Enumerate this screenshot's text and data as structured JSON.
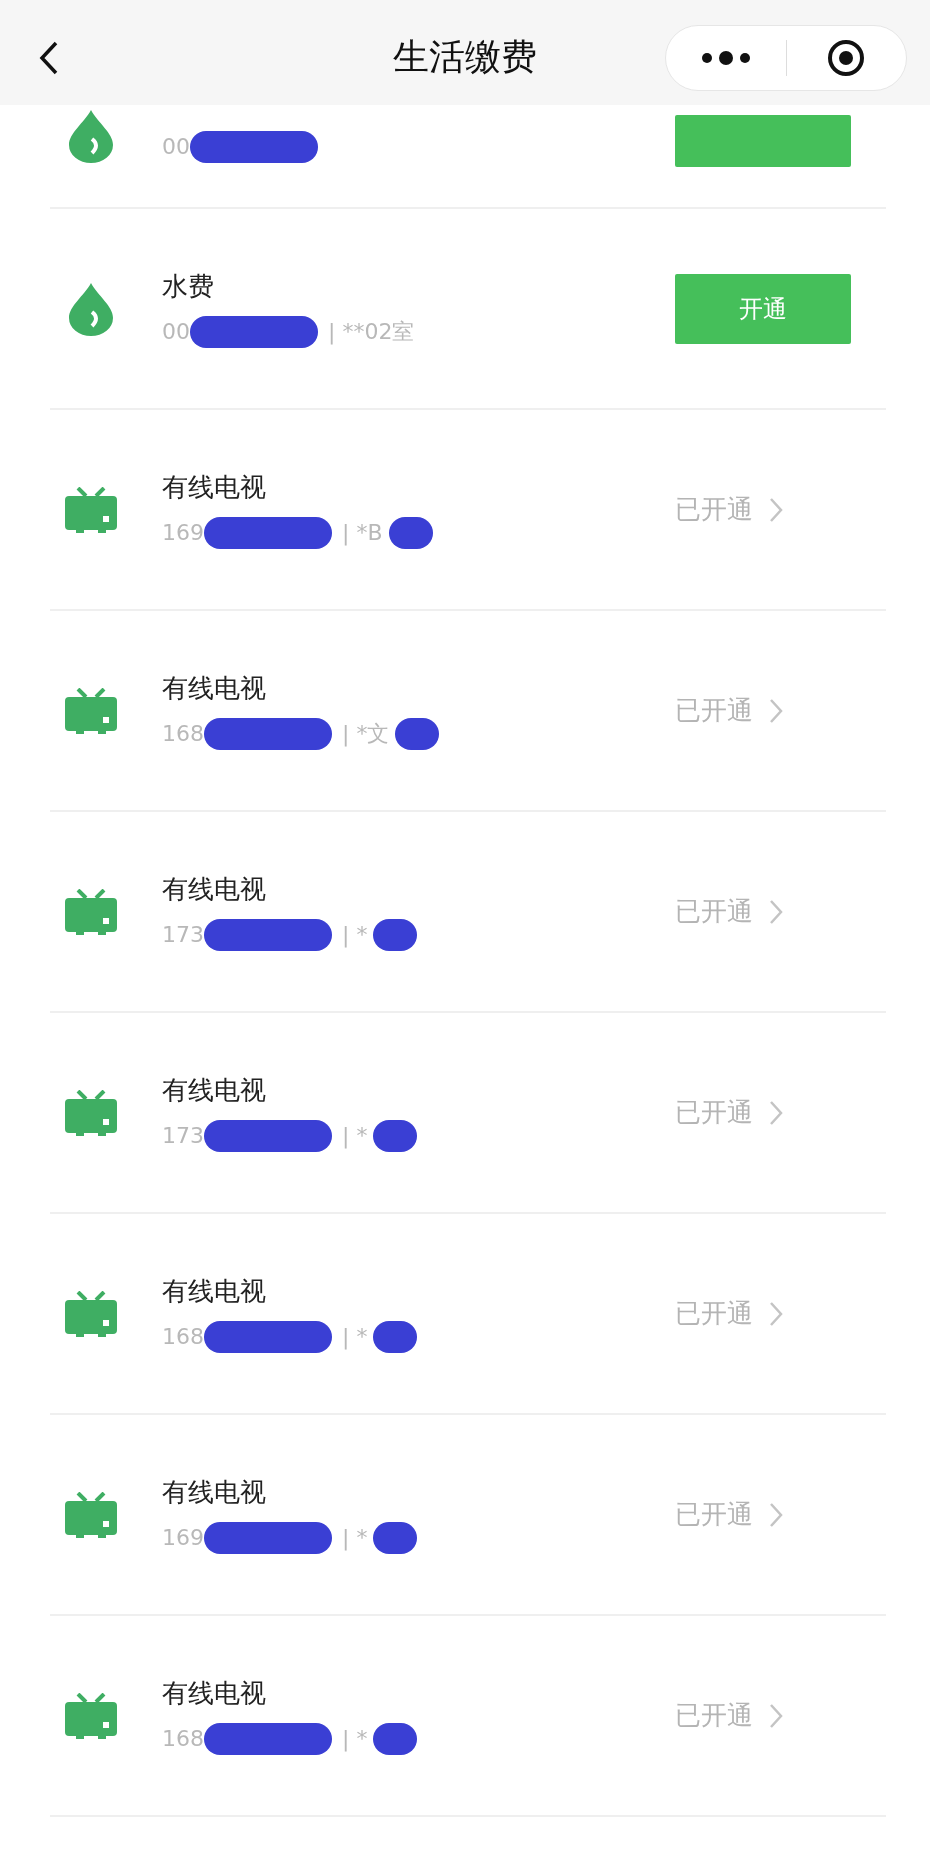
{
  "header": {
    "title": "生活缴费"
  },
  "bills": [
    {
      "kind": "water",
      "activated": false,
      "account_prefix": "00",
      "redacted_tail": false
    },
    {
      "kind": "water",
      "activated": false,
      "title": "水费",
      "account_prefix": "00",
      "account_suffix": "| **02室",
      "redacted_tail": false,
      "action": "开通"
    },
    {
      "kind": "tv",
      "activated": true,
      "title": "有线电视",
      "account_prefix": "169",
      "account_suffix": "| *B",
      "redacted_tail": true,
      "action": "已开通"
    },
    {
      "kind": "tv",
      "activated": true,
      "title": "有线电视",
      "account_prefix": "168",
      "account_suffix": "| *文",
      "redacted_tail": true,
      "action": "已开通"
    },
    {
      "kind": "tv",
      "activated": true,
      "title": "有线电视",
      "account_prefix": "173",
      "account_suffix": "| *",
      "redacted_tail": true,
      "action": "已开通"
    },
    {
      "kind": "tv",
      "activated": true,
      "title": "有线电视",
      "account_prefix": "173",
      "account_suffix": "| *",
      "redacted_tail": true,
      "action": "已开通"
    },
    {
      "kind": "tv",
      "activated": true,
      "title": "有线电视",
      "account_prefix": "168",
      "account_suffix": "| *",
      "redacted_tail": true,
      "action": "已开通"
    },
    {
      "kind": "tv",
      "activated": true,
      "title": "有线电视",
      "account_prefix": "169",
      "account_suffix": "| *",
      "redacted_tail": true,
      "action": "已开通"
    },
    {
      "kind": "tv",
      "activated": true,
      "title": "有线电视",
      "account_prefix": "168",
      "account_suffix": "| *",
      "redacted_tail": true,
      "action": "已开通"
    }
  ]
}
